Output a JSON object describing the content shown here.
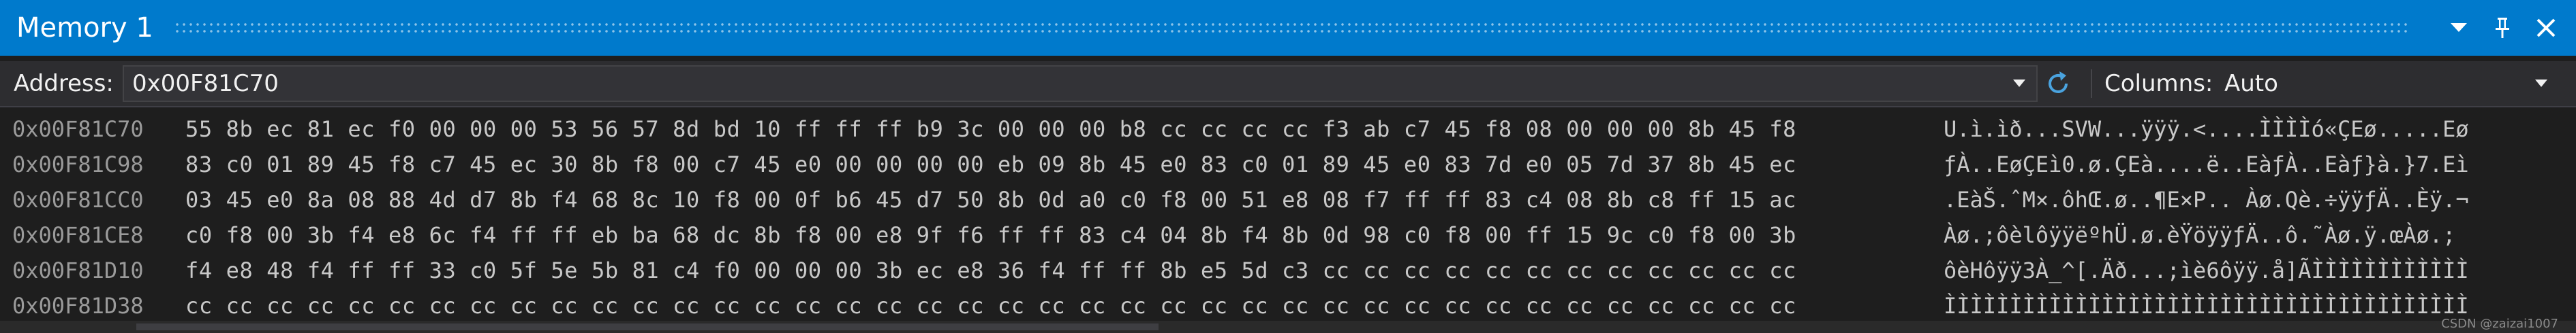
{
  "window": {
    "title": "Memory 1"
  },
  "toolbar": {
    "address_label": "Address:",
    "address_value": "0x00F81C70",
    "columns_label": "Columns:",
    "columns_value": "Auto"
  },
  "memory_rows": [
    {
      "address": "0x00F81C70",
      "hex": "55 8b ec 81 ec f0 00 00 00 53 56 57 8d bd 10 ff ff ff b9 3c 00 00 00 b8 cc cc cc cc f3 ab c7 45 f8 08 00 00 00 8b 45 f8",
      "ascii": "U.ì.ìð...SVW...ÿÿÿ.<....ÌÌÌÌó«ÇEø.....Eø"
    },
    {
      "address": "0x00F81C98",
      "hex": "83 c0 01 89 45 f8 c7 45 ec 30 8b f8 00 c7 45 e0 00 00 00 00 eb 09 8b 45 e0 83 c0 01 89 45 e0 83 7d e0 05 7d 37 8b 45 ec",
      "ascii": "ƒÀ..EøÇEì0.ø.ÇEà....ë..EàƒÀ..Eàƒ}à.}7.Eì"
    },
    {
      "address": "0x00F81CC0",
      "hex": "03 45 e0 8a 08 88 4d d7 8b f4 68 8c 10 f8 00 0f b6 45 d7 50 8b 0d a0 c0 f8 00 51 e8 08 f7 ff ff 83 c4 08 8b c8 ff 15 ac",
      "ascii": ".EàŠ.ˆM×.ôhŒ.ø..¶E×P.. Àø.Qè.÷ÿÿƒÄ..Èÿ.¬"
    },
    {
      "address": "0x00F81CE8",
      "hex": "c0 f8 00 3b f4 e8 6c f4 ff ff eb ba 68 dc 8b f8 00 e8 9f f6 ff ff 83 c4 04 8b f4 8b 0d 98 c0 f8 00 ff 15 9c c0 f8 00 3b",
      "ascii": "Àø.;ôèlôÿÿëºhÜ.ø.èŸöÿÿƒÄ..ô.˜Àø.ÿ.œÀø.;"
    },
    {
      "address": "0x00F81D10",
      "hex": "f4 e8 48 f4 ff ff 33 c0 5f 5e 5b 81 c4 f0 00 00 00 3b ec e8 36 f4 ff ff 8b e5 5d c3 cc cc cc cc cc cc cc cc cc cc cc cc",
      "ascii": "ôèHôÿÿ3À_^[.Äð...;ìè6ôÿÿ.å]ÃÌÌÌÌÌÌÌÌÌÌÌÌ"
    },
    {
      "address": "0x00F81D38",
      "hex": "cc cc cc cc cc cc cc cc cc cc cc cc cc cc cc cc cc cc cc cc cc cc cc cc cc cc cc cc cc cc cc cc cc cc cc cc cc cc cc cc",
      "ascii": "ÌÌÌÌÌÌÌÌÌÌÌÌÌÌÌÌÌÌÌÌÌÌÌÌÌÌÌÌÌÌÌÌÌÌÌÌÌÌÌÌ"
    }
  ],
  "watermark": "CSDN @zaizai1007",
  "colors": {
    "titlebar": "#007acc",
    "background": "#1e1e1e",
    "toolbar": "#2d2d30",
    "text": "#c8c8c8",
    "refresh_icon": "#4aa3df"
  },
  "icons": {
    "window_menu": "caret-down-icon",
    "pin": "pin-icon",
    "close": "close-icon",
    "refresh": "refresh-icon"
  }
}
